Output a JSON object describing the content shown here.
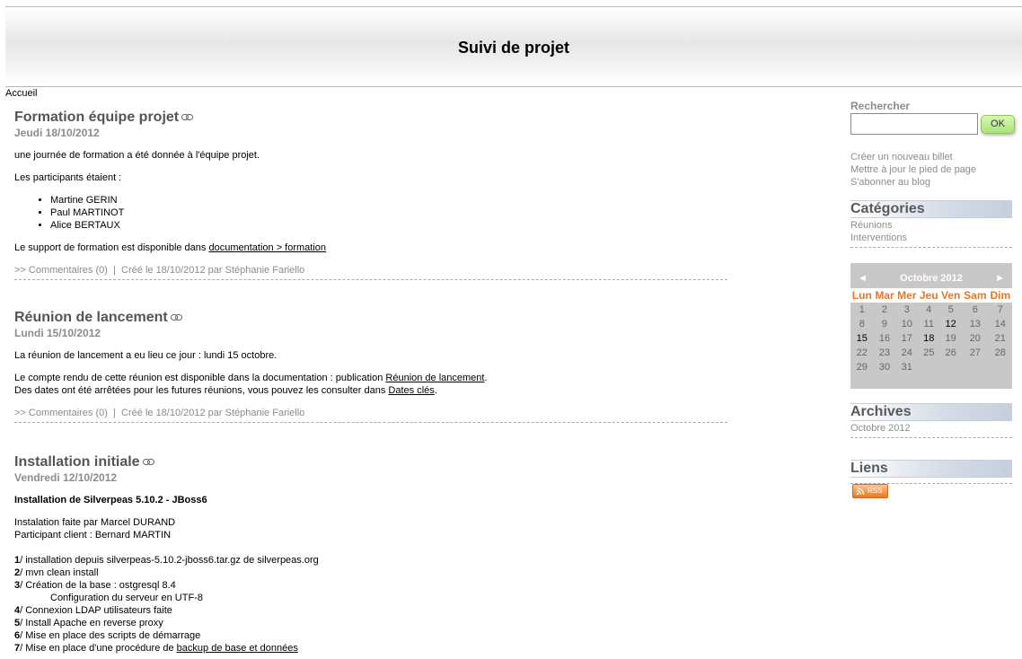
{
  "header": {
    "title": "Suivi de projet"
  },
  "breadcrumb": "Accueil",
  "posts": [
    {
      "title": "Formation équipe projet",
      "date": "Jeudi 18/10/2012",
      "intro": "une journée de formation a été donnée à l'équipe projet.",
      "participants_label": "Les participants étaient :",
      "participants": [
        "Martine GERIN",
        "Paul MARTINOT",
        "Alice BERTAUX"
      ],
      "support_text": "Le support de formation est disponible dans ",
      "support_link": "documentation > formation",
      "comments": ">> Commentaires (0)",
      "sep": "|",
      "created": "Créé le 18/10/2012 par Stéphanie Fariello"
    },
    {
      "title": "Réunion de lancement",
      "date": "Lundi 15/10/2012",
      "line1": "La réunion de lancement a eu lieu ce jour : lundi 15 octobre.",
      "line2_text": "Le compte rendu de cette réunion est disponible dans la documentation : publication ",
      "line2_link": "Réunion de lancement",
      "line2_end": ".",
      "line3_text": "Des dates ont été arrêtées pour les futures réunions, vous pouvez les consulter dans ",
      "line3_link": "Dates clés",
      "line3_end": ".",
      "comments": ">> Commentaires (0)",
      "sep": "|",
      "created": "Créé le 18/10/2012 par Stéphanie Fariello"
    },
    {
      "title": "Installation initiale",
      "date": "Vendredi 12/10/2012",
      "subtitle": "Installation de Silverpeas 5.10.2 - JBoss6",
      "done_by": "Instalation faite par Marcel DURAND",
      "client": "Participant client : Bernard MARTIN",
      "steps": [
        {
          "num": "1",
          "text": "/ installation depuis silverpeas-5.10.2-jboss6.tar.gz de silverpeas.org"
        },
        {
          "num": "2",
          "text": "/ mvn clean install"
        },
        {
          "num": "3",
          "text": "/ Création de la base : ostgresql 8.4"
        },
        {
          "num": "",
          "text": "Configuration du serveur en UTF-8"
        },
        {
          "num": "4",
          "text": "/ Connexion LDAP utilisateurs faite"
        },
        {
          "num": "5",
          "text": "/ Install Apache en reverse proxy"
        },
        {
          "num": "6",
          "text": "/ Mise en place des scripts de démarrage"
        },
        {
          "num": "7",
          "text": "/ Mise en place d'une procédure de ",
          "link": "backup de base et données"
        }
      ]
    }
  ],
  "sidebar": {
    "search_label": "Rechercher",
    "search_value": "",
    "ok_label": "OK",
    "links": [
      "Créer un nouveau billet",
      "Mettre à jour le pied de page",
      "S'abonner au blog"
    ],
    "categories_title": "Catégories",
    "categories": [
      "Réunions",
      "Interventions"
    ],
    "calendar": {
      "prev": "◄",
      "month": "Octobre 2012",
      "next": "►",
      "days": [
        "Lun",
        "Mar",
        "Mer",
        "Jeu",
        "Ven",
        "Sam",
        "Dim"
      ],
      "weeks": [
        [
          "1",
          "2",
          "3",
          "4",
          "5",
          "6",
          "7"
        ],
        [
          "8",
          "9",
          "10",
          "11",
          "12",
          "13",
          "14"
        ],
        [
          "15",
          "16",
          "17",
          "18",
          "19",
          "20",
          "21"
        ],
        [
          "22",
          "23",
          "24",
          "25",
          "26",
          "27",
          "28"
        ],
        [
          "29",
          "30",
          "31",
          "",
          "",
          "",
          ""
        ]
      ],
      "highlighted": [
        "12",
        "15",
        "18"
      ]
    },
    "archives_title": "Archives",
    "archives": [
      "Octobre 2012"
    ],
    "links_title": "Liens",
    "rss_label": "RSS"
  }
}
